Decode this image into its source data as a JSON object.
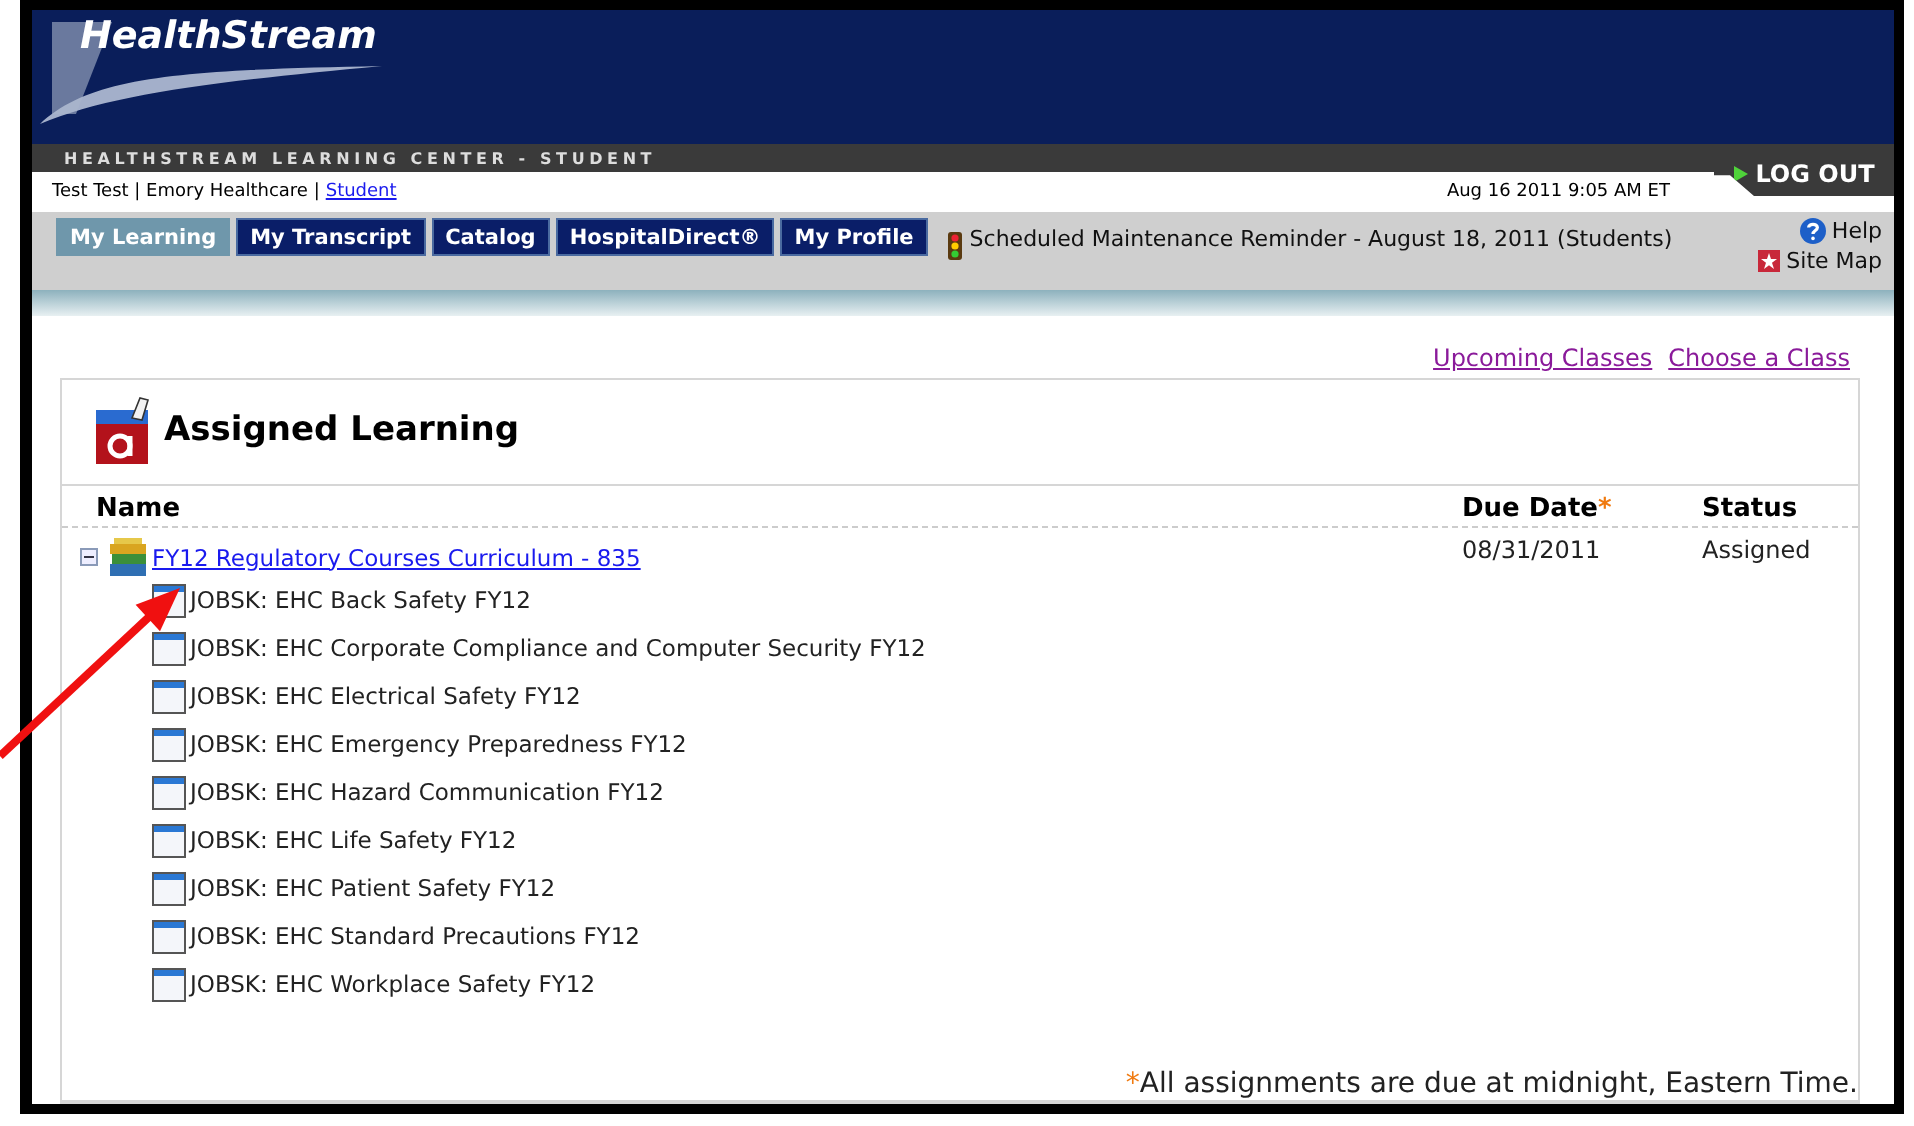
{
  "header": {
    "logo": "HealthStream",
    "subtitle": "HEALTHSTREAM LEARNING CENTER - STUDENT",
    "logout": "LOG OUT"
  },
  "user_bar": {
    "user": "Test Test | Emory Healthcare |",
    "role_link": "Student",
    "datetime": "Aug 16 2011 9:05 AM ET"
  },
  "tabs": [
    {
      "label": "My Learning",
      "selected": true
    },
    {
      "label": "My Transcript",
      "selected": false
    },
    {
      "label": "Catalog",
      "selected": false
    },
    {
      "label": "HospitalDirect®",
      "selected": false
    },
    {
      "label": "My Profile",
      "selected": false
    }
  ],
  "notice": "Scheduled Maintenance Reminder - August 18, 2011 (Students)",
  "help": "Help",
  "site_map": "Site Map",
  "links": [
    "Upcoming Classes",
    "Choose a Class"
  ],
  "panel": {
    "title": "Assigned Learning",
    "columns": [
      {
        "label": "Name"
      },
      {
        "label": "Due Date",
        "asterisk": "*"
      },
      {
        "label": "Status"
      }
    ],
    "curriculum": {
      "title": "FY12 Regulatory Courses Curriculum - 835",
      "expanded": true,
      "due_date": "08/31/2011",
      "status": "Assigned",
      "children": [
        {
          "title": "JOBSK: EHC Back Safety FY12"
        },
        {
          "title": "JOBSK: EHC Corporate Compliance and Computer Security FY12"
        },
        {
          "title": "JOBSK: EHC Electrical Safety FY12"
        },
        {
          "title": "JOBSK: EHC Emergency Preparedness FY12"
        },
        {
          "title": "JOBSK: EHC Hazard Communication FY12"
        },
        {
          "title": "JOBSK: EHC Life Safety FY12"
        },
        {
          "title": "JOBSK: EHC Patient Safety FY12"
        },
        {
          "title": "JOBSK: EHC Standard Precautions FY12"
        },
        {
          "title": "JOBSK: EHC Workplace Safety FY12"
        }
      ]
    },
    "footnote": {
      "mark": "*",
      "text": "All assignments are due at midnight, Eastern Time."
    }
  }
}
